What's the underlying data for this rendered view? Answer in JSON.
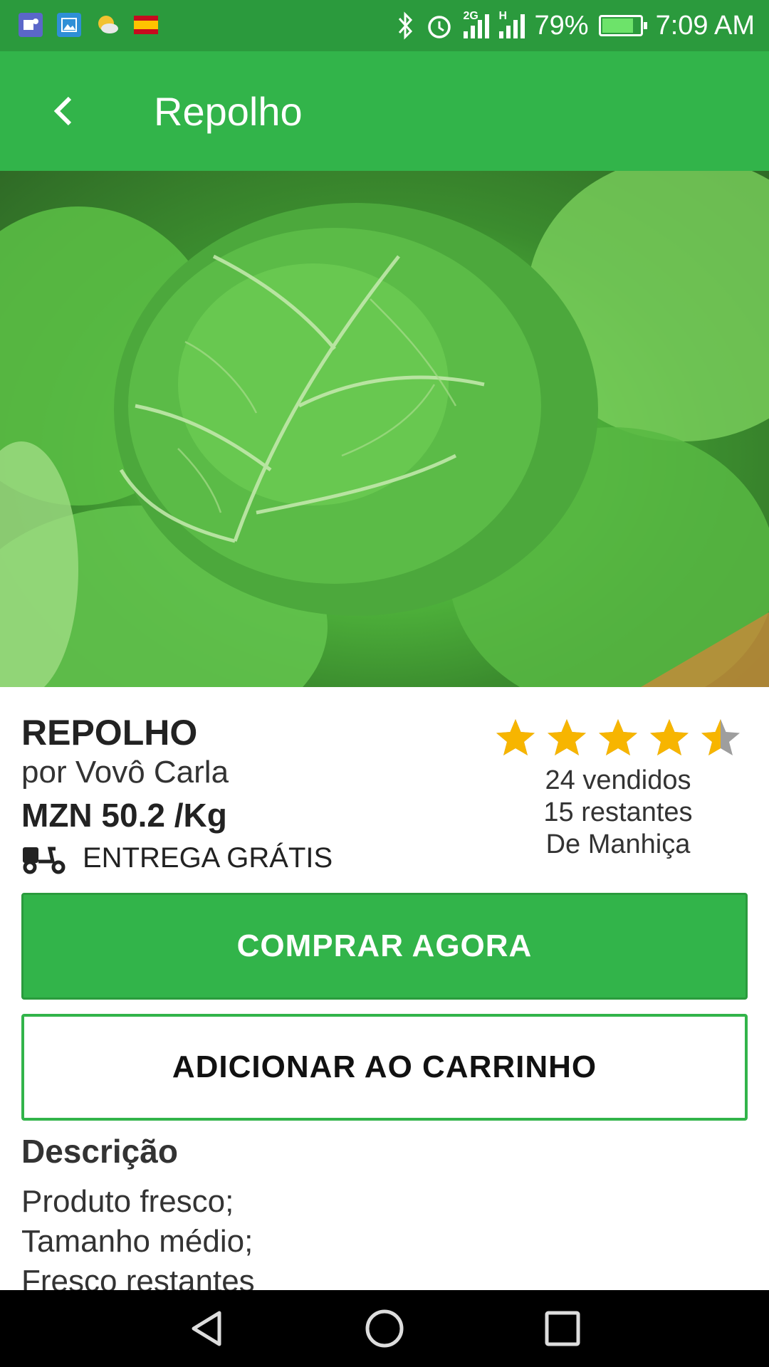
{
  "status_bar": {
    "left_icons": [
      "teams-icon",
      "gallery-icon",
      "weather-icon",
      "spain-flag-icon"
    ],
    "network_2g": "2G",
    "network_h": "H",
    "battery_percent": "79%",
    "battery_level": 0.79,
    "time": "7:09 AM"
  },
  "app_bar": {
    "title": "Repolho",
    "back_icon": "chevron-left-icon"
  },
  "product": {
    "name": "REPOLHO",
    "seller": "por Vovô Carla",
    "price": "MZN 50.2 /Kg",
    "delivery": "ENTREGA GRÁTIS",
    "rating": 4.5,
    "rating_max": 5,
    "sold": "24 vendidos",
    "remaining": "15 restantes",
    "origin": "De Manhiça"
  },
  "actions": {
    "buy_now": "COMPRAR AGORA",
    "add_to_cart": "ADICIONAR AO CARRINHO"
  },
  "description": {
    "title": "Descrição",
    "lines": [
      "Produto fresco;",
      "Tamanho médio;",
      "Fresco restantes"
    ]
  },
  "colors": {
    "status_bar": "#2b9a3d",
    "primary": "#32b44a",
    "star": "#f7b500"
  }
}
